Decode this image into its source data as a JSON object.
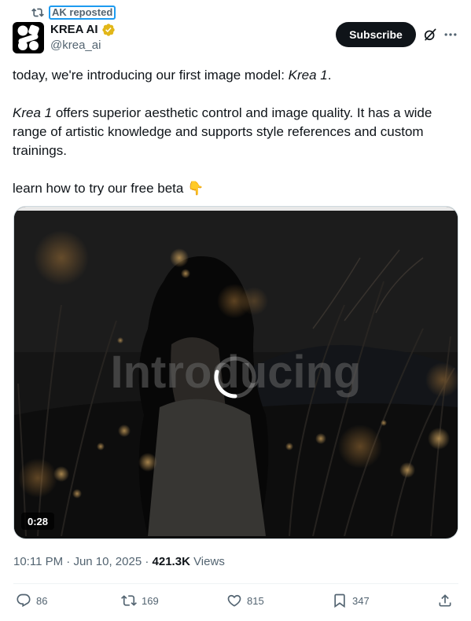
{
  "repost": {
    "label": "AK reposted"
  },
  "author": {
    "name": "KREA AI",
    "handle": "@krea_ai"
  },
  "header": {
    "subscribe_label": "Subscribe"
  },
  "tweet": {
    "line1_pre": "today, we're introducing our first image model: ",
    "line1_em": "Krea 1",
    "line1_post": ".",
    "para2_em": "Krea 1",
    "para2_post": " offers superior aesthetic control and image quality. It has a wide range of artistic knowledge and supports style references and custom trainings.",
    "line3": "learn how to try our free beta",
    "line3_emoji": "👇"
  },
  "media": {
    "overlay_text": "Introducing",
    "duration": "0:28"
  },
  "meta": {
    "time": "10:11 PM",
    "separator": " · ",
    "date": "Jun 10, 2025",
    "views_count": "421.3K",
    "views_label": " Views"
  },
  "actions": {
    "replies": "86",
    "reposts": "169",
    "likes": "815",
    "bookmarks": "347"
  },
  "colors": {
    "accent": "#1d9bf0",
    "text": "#0f1419",
    "muted": "#536471",
    "verified_gold": "#e2b719"
  }
}
